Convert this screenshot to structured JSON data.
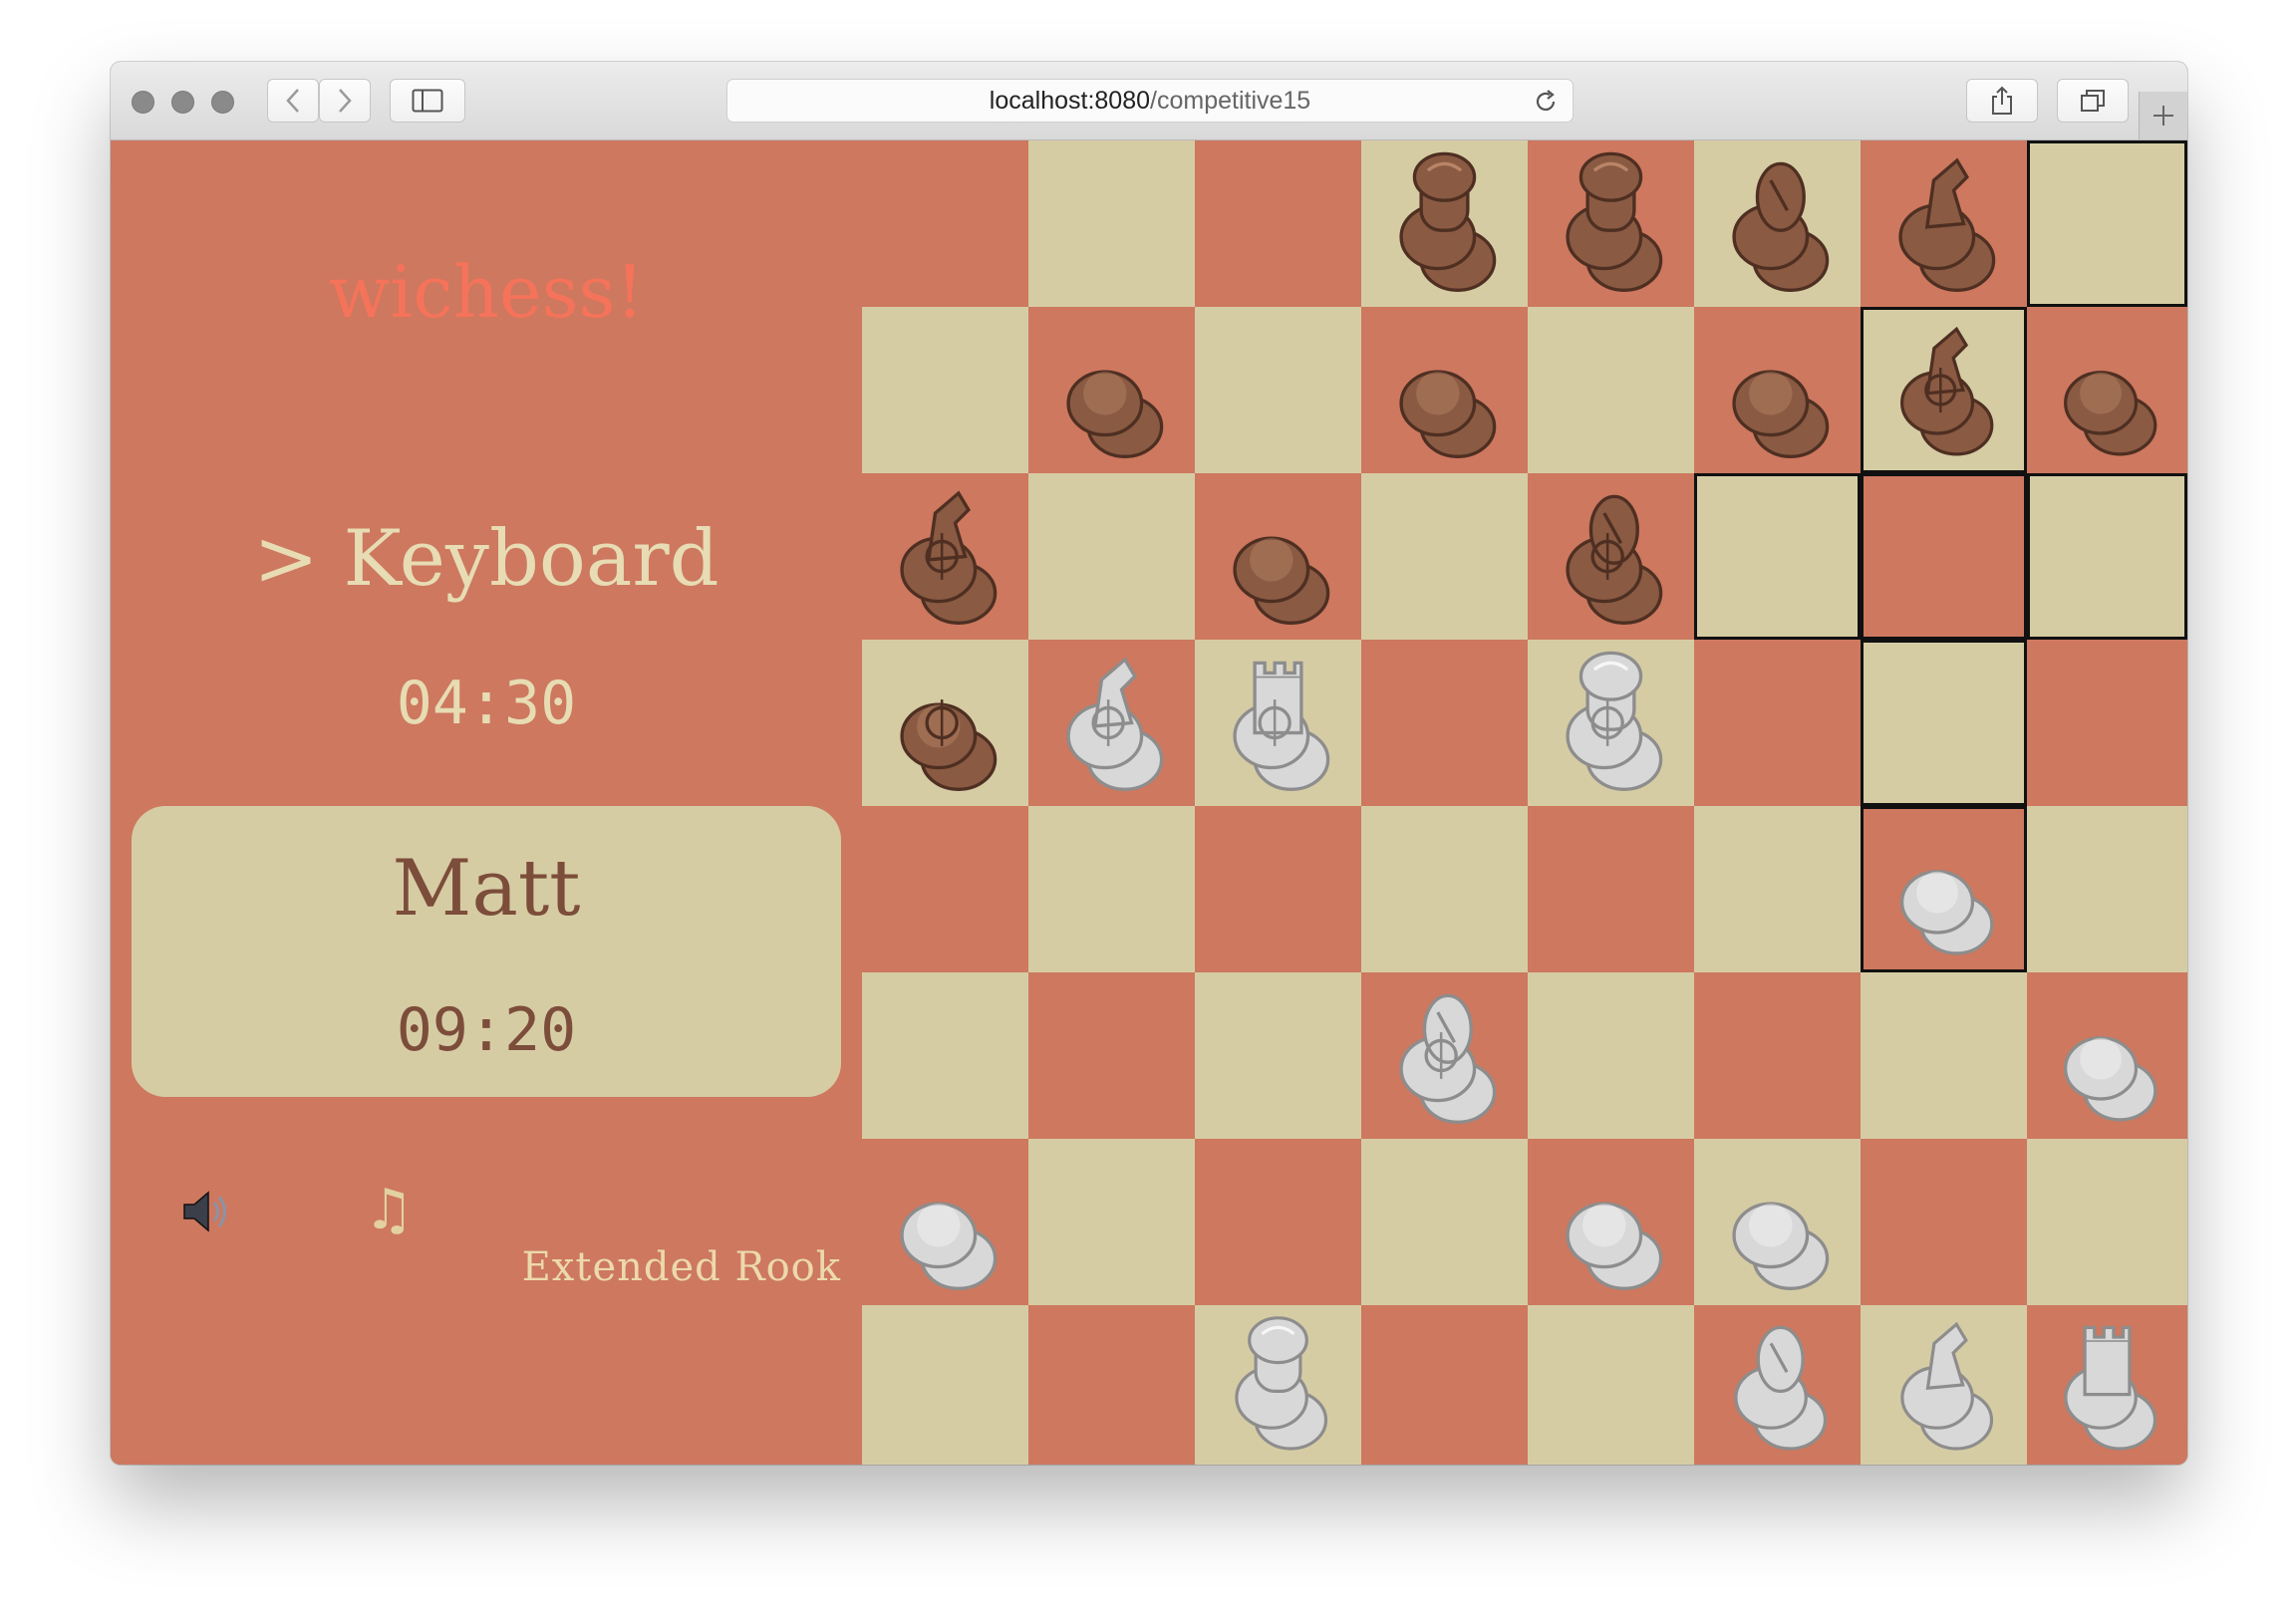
{
  "browser": {
    "url_host": "localhost:8080",
    "url_path": "/competitive15"
  },
  "app": {
    "title": "wichess!"
  },
  "opponent": {
    "name": "> Keyboard",
    "time": "04:30"
  },
  "player": {
    "name": "Matt",
    "time": "09:20"
  },
  "controls": {
    "sound_icon": "speaker-icon",
    "music_icon": "music-note-icon",
    "music_glyph": "♫"
  },
  "variant": {
    "label": "Extended Rook"
  },
  "colors": {
    "dark_square": "#cd785f",
    "light_square": "#d6cca4",
    "title": "#f5735a",
    "dark_piece": "#8a5a42",
    "light_piece": "#d8d8d8",
    "highlight": "#111111"
  },
  "board": {
    "rows": [
      [
        null,
        null,
        null,
        "black-queen",
        "black-king",
        "black-bishop",
        "black-knight",
        null
      ],
      [
        null,
        "black-pawn",
        null,
        "black-pawn",
        null,
        "black-pawn",
        "black-knight-variant",
        "black-pawn"
      ],
      [
        "black-knight-variant",
        null,
        "black-pawn",
        null,
        "black-bishop-variant",
        null,
        null,
        null
      ],
      [
        "black-pawn-variant",
        "white-knight-variant",
        "white-rook-variant",
        null,
        "white-king-variant",
        null,
        null,
        null
      ],
      [
        null,
        null,
        null,
        null,
        null,
        null,
        "white-pawn",
        null
      ],
      [
        null,
        null,
        null,
        "white-bishop-variant",
        null,
        null,
        null,
        "white-pawn"
      ],
      [
        "white-pawn",
        null,
        null,
        null,
        "white-pawn",
        "white-pawn",
        null,
        null
      ],
      [
        null,
        null,
        "white-queen",
        null,
        null,
        "white-bishop",
        "white-knight",
        "white-rook"
      ]
    ],
    "highlighted": [
      [
        0,
        7
      ],
      [
        1,
        6
      ],
      [
        2,
        5
      ],
      [
        2,
        6
      ],
      [
        2,
        7
      ],
      [
        3,
        6
      ],
      [
        4,
        6
      ]
    ]
  }
}
